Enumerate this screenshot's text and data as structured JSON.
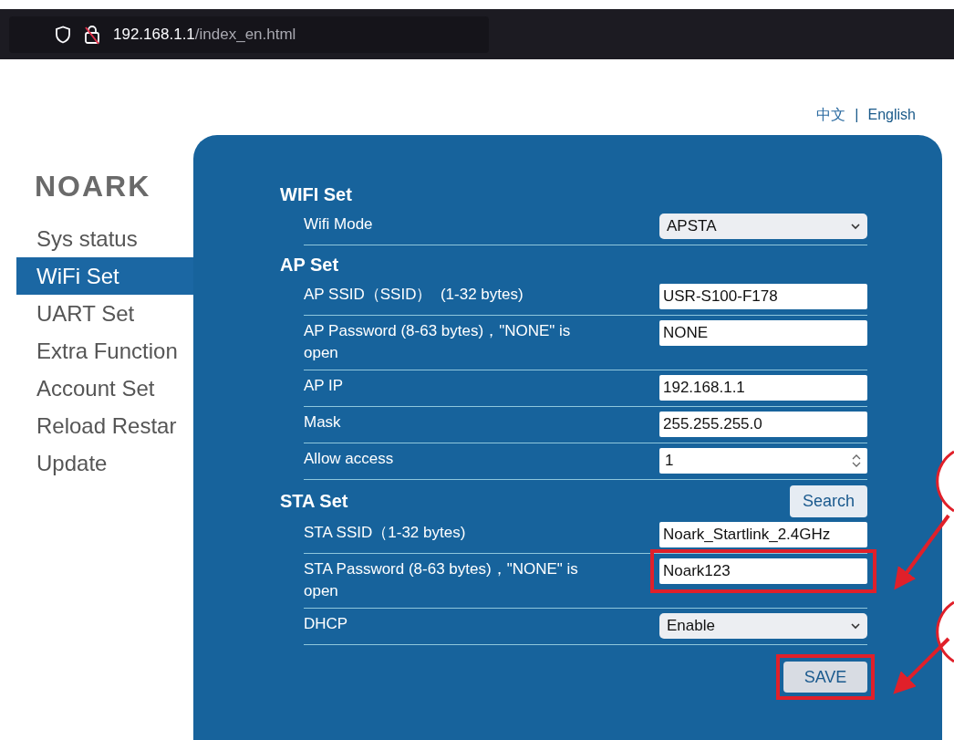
{
  "browser": {
    "url_host": "192.168.1.1",
    "url_path": "/index_en.html"
  },
  "language_separator": "|",
  "language_links": [
    {
      "label": "中文",
      "selected": false
    },
    {
      "label": "English",
      "selected": true
    }
  ],
  "logo": "NOARK",
  "sidebar": {
    "items": [
      {
        "label": "Sys status",
        "selected": false
      },
      {
        "label": "WiFi Set",
        "selected": true
      },
      {
        "label": "UART Set",
        "selected": false
      },
      {
        "label": "Extra Function",
        "selected": false
      },
      {
        "label": "Account Set",
        "selected": false
      },
      {
        "label": "Reload Restar",
        "selected": false
      },
      {
        "label": "Update",
        "selected": false
      }
    ]
  },
  "sections": [
    {
      "title": "WIFI Set",
      "rows": [
        {
          "label": "Wifi Mode",
          "kind": "select",
          "value": "APSTA",
          "highlighted": false
        }
      ]
    },
    {
      "title": "AP Set",
      "rows": [
        {
          "label": "AP SSID（SSID）  (1-32 bytes)",
          "kind": "text",
          "value": "USR-S100-F178",
          "highlighted": false
        },
        {
          "label": "AP Password (8-63 bytes)，\"NONE\" is open",
          "kind": "text",
          "value": "NONE",
          "highlighted": false
        },
        {
          "label": "AP IP",
          "kind": "text",
          "value": "192.168.1.1",
          "highlighted": false
        },
        {
          "label": "Mask",
          "kind": "text",
          "value": "255.255.255.0",
          "highlighted": false
        },
        {
          "label": "Allow access",
          "kind": "number",
          "value": "1",
          "highlighted": false
        }
      ]
    },
    {
      "title": "STA Set",
      "button": "Search",
      "rows": [
        {
          "label": "STA SSID（1-32 bytes)",
          "kind": "text",
          "value": "Noark_Startlink_2.4GHz",
          "highlighted": false
        },
        {
          "label": "STA Password (8-63 bytes)，\"NONE\" is open",
          "kind": "text",
          "value": "Noark123",
          "highlighted": true
        },
        {
          "label": "DHCP",
          "kind": "select",
          "value": "Enable",
          "highlighted": false
        }
      ]
    }
  ],
  "save_button": {
    "label": "SAVE",
    "highlighted": true
  }
}
